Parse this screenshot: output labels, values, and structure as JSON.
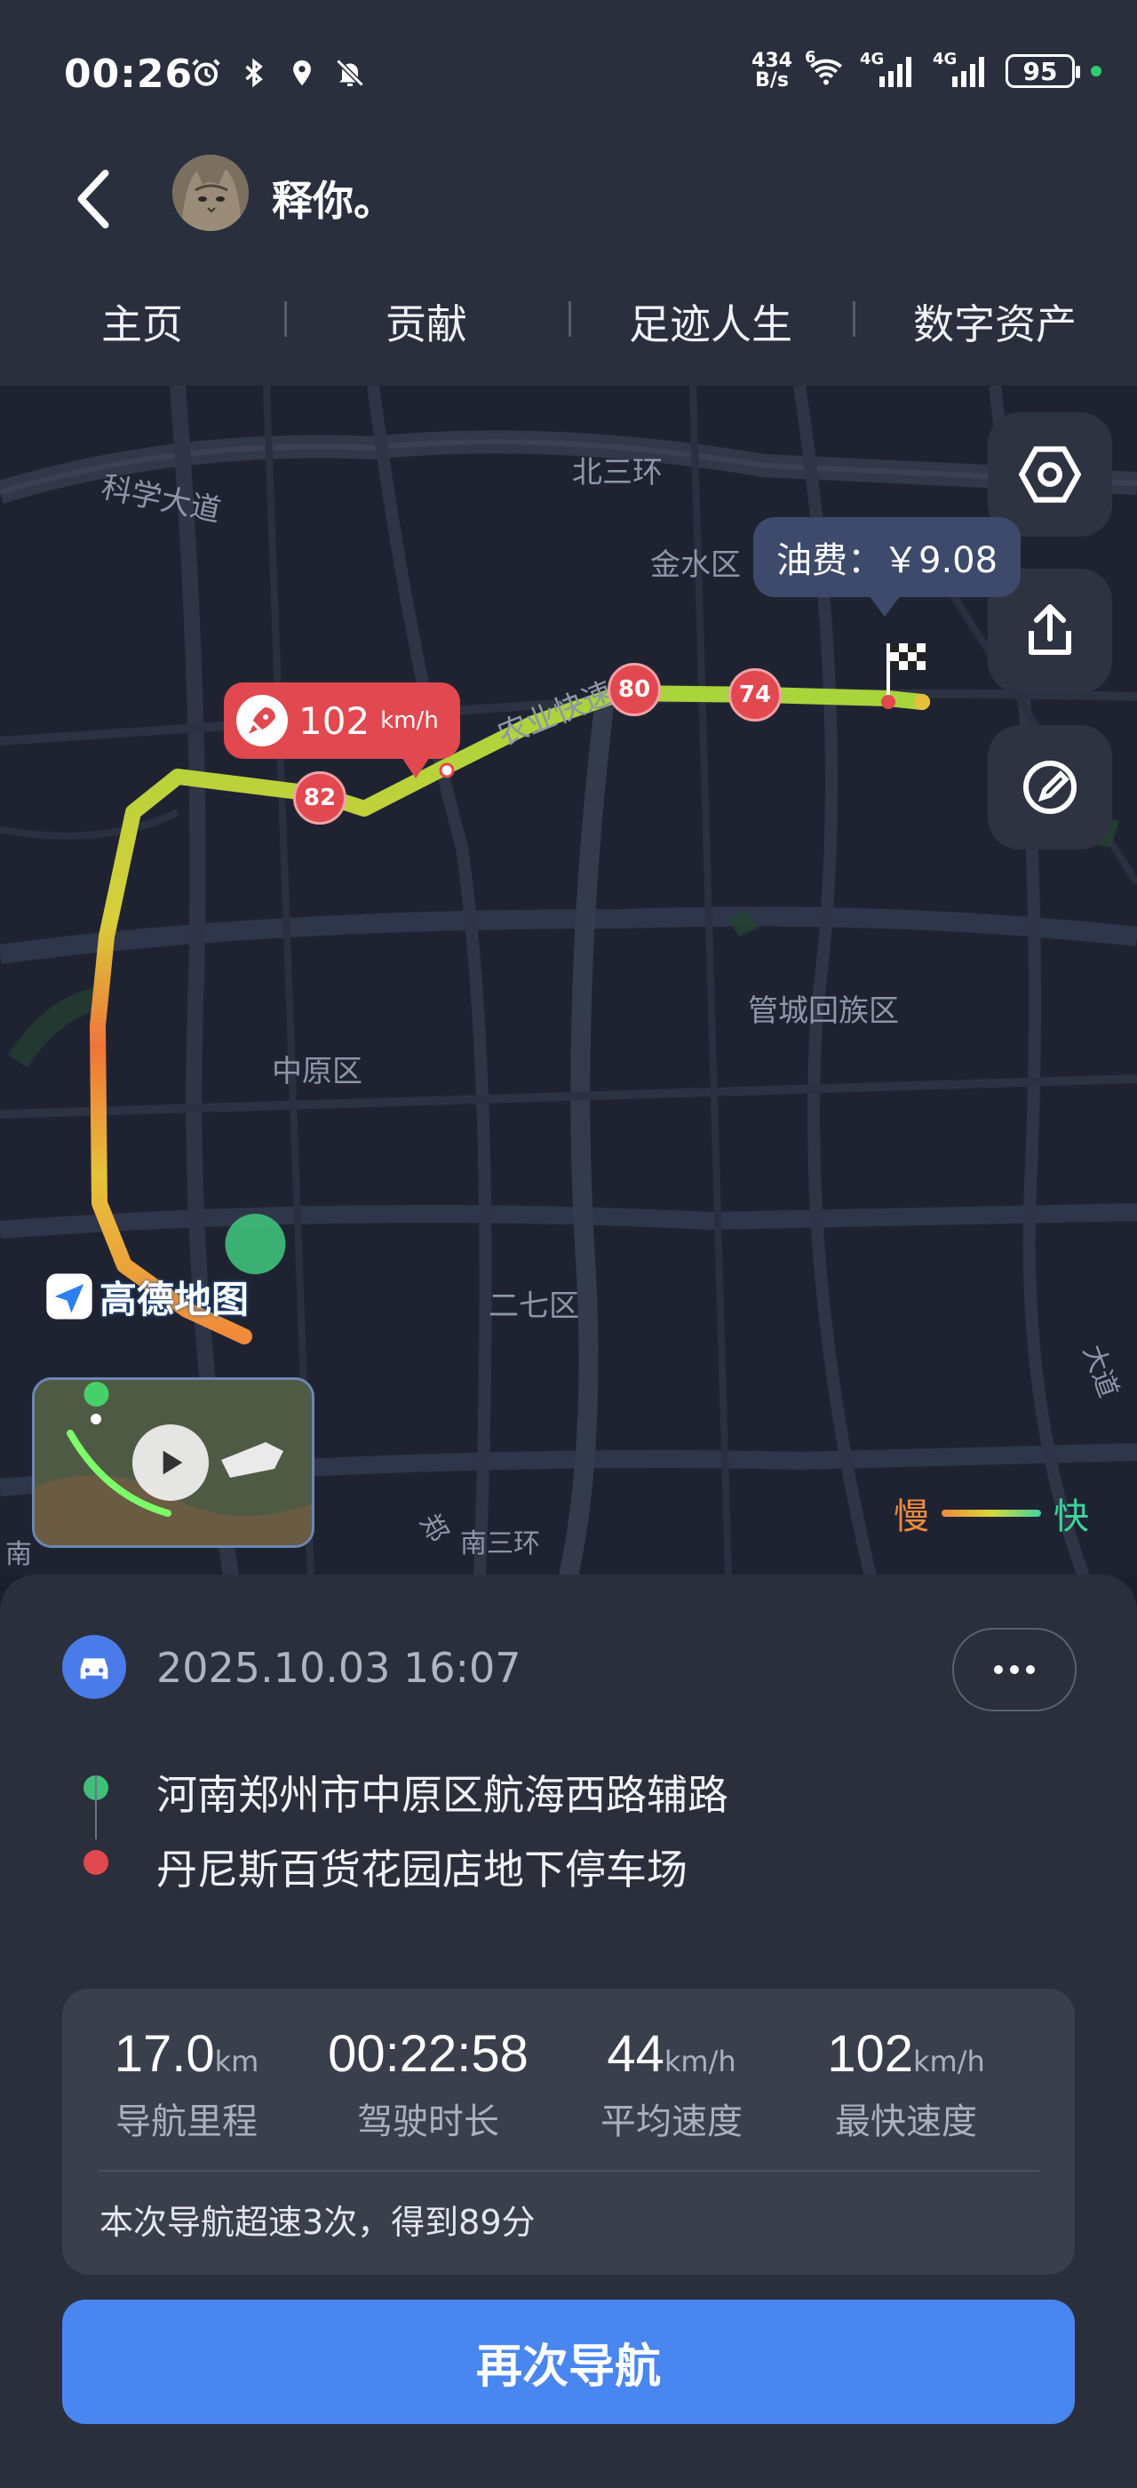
{
  "status_bar": {
    "time": "00:26",
    "net_speed_value": "434",
    "net_speed_unit": "B/s",
    "signal_1": "4G",
    "signal_2": "4G",
    "wifi_label": "6",
    "battery": "95"
  },
  "header": {
    "username": "释你。"
  },
  "tabs": [
    "主页",
    "贡献",
    "足迹人生",
    "数字资产"
  ],
  "map": {
    "labels": {
      "beisanhuan": "北三环",
      "kexuedadao": "科学大道",
      "jinshuiqu": "金水区",
      "nongye": "农业快速",
      "guancheng": "管城回族区",
      "zhongyuan": "中原区",
      "erqi": "二七区",
      "nansanhuan": "南三环",
      "zheng": "郑",
      "nan": "南",
      "dadao": "大道"
    },
    "fuel_tip": "油费：￥9.08",
    "top_speed_tip": {
      "value": "102",
      "unit": "km/h"
    },
    "speed_badges": [
      "82",
      "80",
      "74"
    ],
    "watermark": "高德地图",
    "legend": {
      "slow": "慢",
      "fast": "快"
    }
  },
  "trip": {
    "datetime": "2025.10.03 16:07",
    "start_address": "河南郑州市中原区航海西路辅路",
    "end_address": "丹尼斯百货花园店地下停车场"
  },
  "stats": [
    {
      "value": "17.0",
      "unit": "km",
      "label": "导航里程"
    },
    {
      "value": "00:22:58",
      "unit": "",
      "label": "驾驶时长"
    },
    {
      "value": "44",
      "unit": "km/h",
      "label": "平均速度"
    },
    {
      "value": "102",
      "unit": "km/h",
      "label": "最快速度"
    }
  ],
  "summary": "本次导航超速3次，得到89分",
  "nav_again": "再次导航",
  "colors": {
    "accent_blue": "#4a86f0",
    "speed_red": "#e2484f",
    "slow": "#f08a3c",
    "fast": "#3fd39c"
  }
}
